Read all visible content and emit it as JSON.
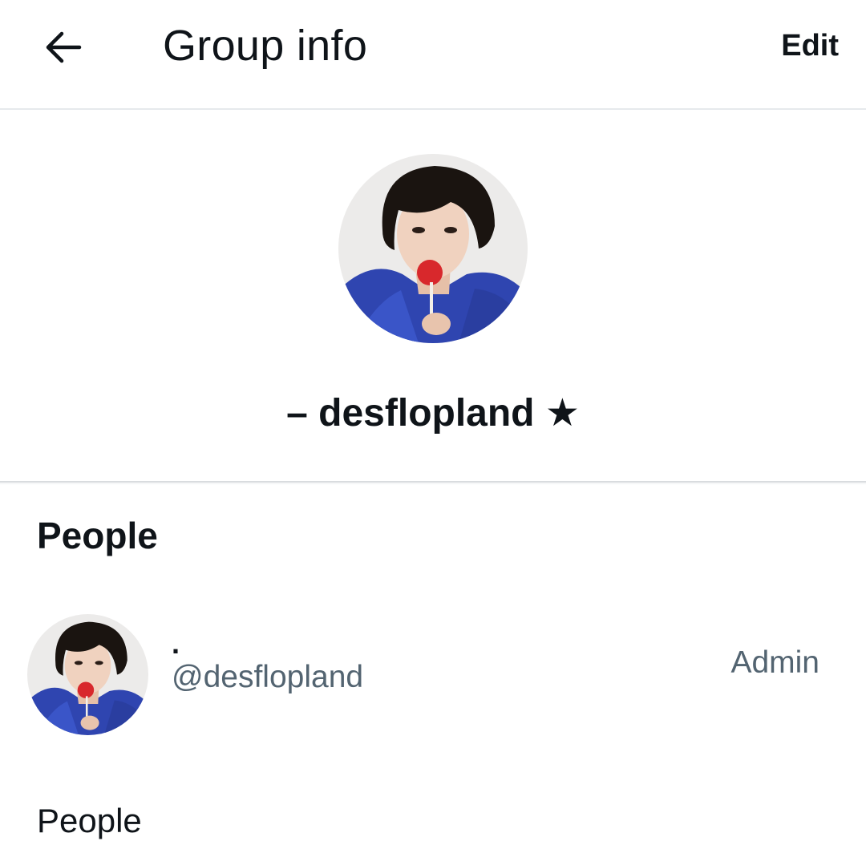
{
  "header": {
    "back_icon": "arrow-left-icon",
    "title": "Group info",
    "edit_label": "Edit"
  },
  "group": {
    "avatar_alt": "group-avatar-photo",
    "name": "– desflopland ★"
  },
  "people_section": {
    "title": "People",
    "members": [
      {
        "display_name": ".",
        "handle": "@desflopland",
        "role": "Admin"
      }
    ]
  },
  "footer": {
    "label": "People"
  },
  "colors": {
    "text_primary": "#0f1419",
    "text_secondary": "#536471",
    "divider": "#d9dcdf"
  }
}
